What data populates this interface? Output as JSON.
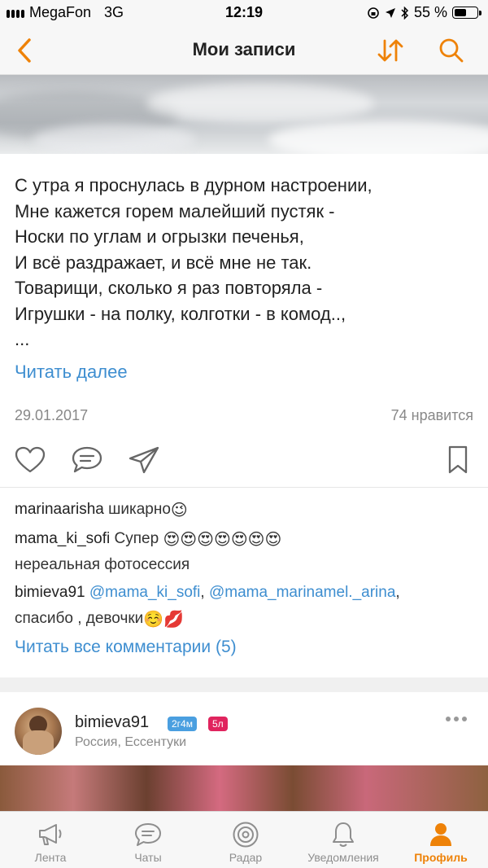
{
  "status_bar": {
    "carrier": "MegaFon",
    "network": "3G",
    "time": "12:19",
    "battery_text": "55 %",
    "battery_level": 0.55
  },
  "nav": {
    "title": "Мои записи",
    "back_icon": "chevron-left-icon",
    "sort_icon": "sort-icon",
    "search_icon": "search-icon"
  },
  "post": {
    "text_lines": [
      "С утра я проснулась в дурном настроении,",
      "Мне кажется горем малейший пустяк -",
      "Носки по углам и огрызки печенья,",
      "И всё раздражает, и всё мне не так.",
      "Товарищи, сколько я раз повторяла -",
      "Игрушки - на полку, колготки - в комод..,",
      "..."
    ],
    "read_more": "Читать далее",
    "date": "29.01.2017",
    "likes": "74 нравится"
  },
  "comments": [
    {
      "user": "marinaarisha",
      "text": "шикарно",
      "emoji": "😉"
    },
    {
      "user": "mama_ki_sofi",
      "text": "Супер",
      "emoji": "😍😍😍😍😍😍😍",
      "text2": "нереальная фотосессия"
    },
    {
      "user": "bimieva91",
      "mention1": "@mama_ki_sofi",
      "sep": ",",
      "mention2": "@mama_marinamel._arina",
      "tail": ",",
      "text2": "спасибо , девочки",
      "emoji": "☺️💋"
    }
  ],
  "read_all": "Читать все комментарии (5)",
  "next_post": {
    "username": "bimieva91",
    "badge_age": "2г4м",
    "badge_level": "5л",
    "location": "Россия, Ессентуки"
  },
  "tabs": [
    {
      "label": "Лента",
      "icon": "megaphone-icon",
      "active": false
    },
    {
      "label": "Чаты",
      "icon": "chat-icon",
      "active": false
    },
    {
      "label": "Радар",
      "icon": "radar-icon",
      "active": false
    },
    {
      "label": "Уведомления",
      "icon": "bell-icon",
      "active": false
    },
    {
      "label": "Профиль",
      "icon": "profile-icon",
      "active": true
    }
  ],
  "colors": {
    "accent": "#ee8208",
    "link": "#3e8ed0",
    "badge_age": "#4a9fe0",
    "badge_level": "#e0245e"
  }
}
